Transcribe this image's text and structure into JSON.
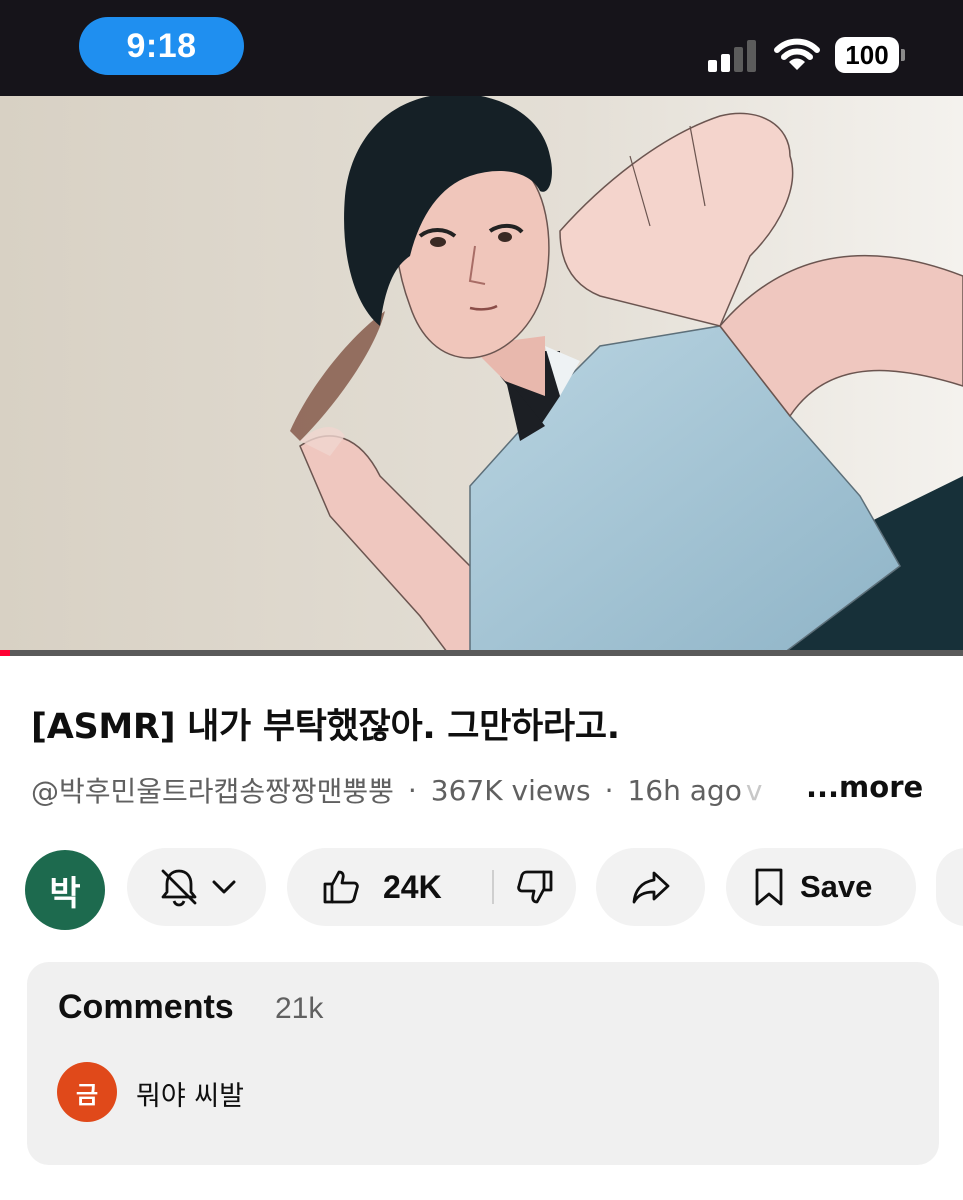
{
  "status_bar": {
    "time": "9:18",
    "battery": "100",
    "signal_bars_active": 2,
    "signal_bars_total": 4,
    "colors": {
      "time_pill": "#1f8ff0",
      "background": "#16141a"
    }
  },
  "video": {
    "thumbnail": "anime-style illustration of a young man in a light blue polo shirt",
    "progress": 0.01,
    "progress_color": "#ff0033"
  },
  "details": {
    "title": "[ASMR] 내가 부탁했잖아. 그만하라고.",
    "channel_handle": "@박후민울트라캡송짱짱맨뿡뿡",
    "separator": "·",
    "views": "367K views",
    "age": "16h ago",
    "truncated_tail": "v",
    "more_label": "...more"
  },
  "actions": {
    "channel_avatar_initial": "박",
    "channel_avatar_color": "#1d6a4e",
    "notifications_icon": "bell-off-icon",
    "likes": "24K",
    "save_label": "Save"
  },
  "comments": {
    "title": "Comments",
    "count": "21k",
    "top_comment": {
      "avatar_initial": "금",
      "avatar_color": "#e0491a",
      "text": "뭐야 씨발"
    }
  }
}
